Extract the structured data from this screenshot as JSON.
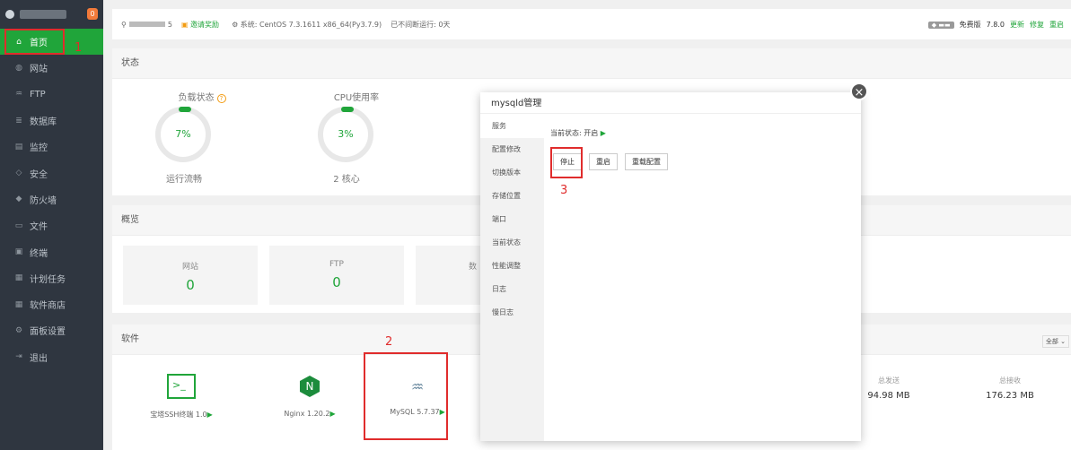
{
  "sidebar": {
    "badge": "0",
    "items": [
      {
        "label": "首页",
        "icon": "home-icon",
        "glyph": "⌂"
      },
      {
        "label": "网站",
        "icon": "globe-icon",
        "glyph": "◍"
      },
      {
        "label": "FTP",
        "icon": "ftp-icon",
        "glyph": "♒"
      },
      {
        "label": "数据库",
        "icon": "database-icon",
        "glyph": "≣"
      },
      {
        "label": "监控",
        "icon": "monitor-icon",
        "glyph": "▤"
      },
      {
        "label": "安全",
        "icon": "shield-icon",
        "glyph": "◇"
      },
      {
        "label": "防火墙",
        "icon": "firewall-icon",
        "glyph": "◆"
      },
      {
        "label": "文件",
        "icon": "folder-icon",
        "glyph": "▭"
      },
      {
        "label": "终端",
        "icon": "terminal-icon",
        "glyph": "▣"
      },
      {
        "label": "计划任务",
        "icon": "calendar-icon",
        "glyph": "▦"
      },
      {
        "label": "软件商店",
        "icon": "grid-icon",
        "glyph": "▦"
      },
      {
        "label": "面板设置",
        "icon": "gear-icon",
        "glyph": "⚙"
      },
      {
        "label": "退出",
        "icon": "logout-icon",
        "glyph": "⇥"
      }
    ]
  },
  "topbar": {
    "user_suffix": "5",
    "gift": "邀请奖励",
    "system": "系统: CentOS 7.3.1611 x86_64(Py3.7.9)",
    "uptime": "已不间断运行: 0天",
    "edition": "免费版",
    "version": "7.8.0",
    "update": "更新",
    "repair": "修复",
    "restart": "重启"
  },
  "status": {
    "title": "状态",
    "load_label": "负载状态",
    "load_value": "7%",
    "load_sub": "运行流畅",
    "cpu_label": "CPU使用率",
    "cpu_value": "3%",
    "cpu_sub": "2 核心"
  },
  "overview": {
    "title": "概览",
    "site_label": "网站",
    "site_value": "0",
    "ftp_label": "FTP",
    "ftp_value": "0",
    "db_label_partial": "数"
  },
  "software": {
    "title": "软件",
    "filter": "全部",
    "items": [
      {
        "name": "宝塔SSH终端 1.0"
      },
      {
        "name": "Nginx 1.20.2"
      },
      {
        "name": "MySQL 5.7.37"
      }
    ],
    "sent_label": "总发送",
    "sent_value": "94.98 MB",
    "recv_label": "总接收",
    "recv_value": "176.23 MB"
  },
  "modal": {
    "title": "mysqld管理",
    "close": "×",
    "menu": [
      "服务",
      "配置修改",
      "切换版本",
      "存储位置",
      "端口",
      "当前状态",
      "性能调整",
      "日志",
      "慢日志"
    ],
    "status_text": "当前状态: 开启",
    "stop": "停止",
    "restart": "重启",
    "reload": "重载配置"
  },
  "annotations": {
    "n1": "1",
    "n2": "2",
    "n3": "3"
  },
  "colors": {
    "accent": "#20a53a",
    "annotation": "#e02c2c"
  }
}
